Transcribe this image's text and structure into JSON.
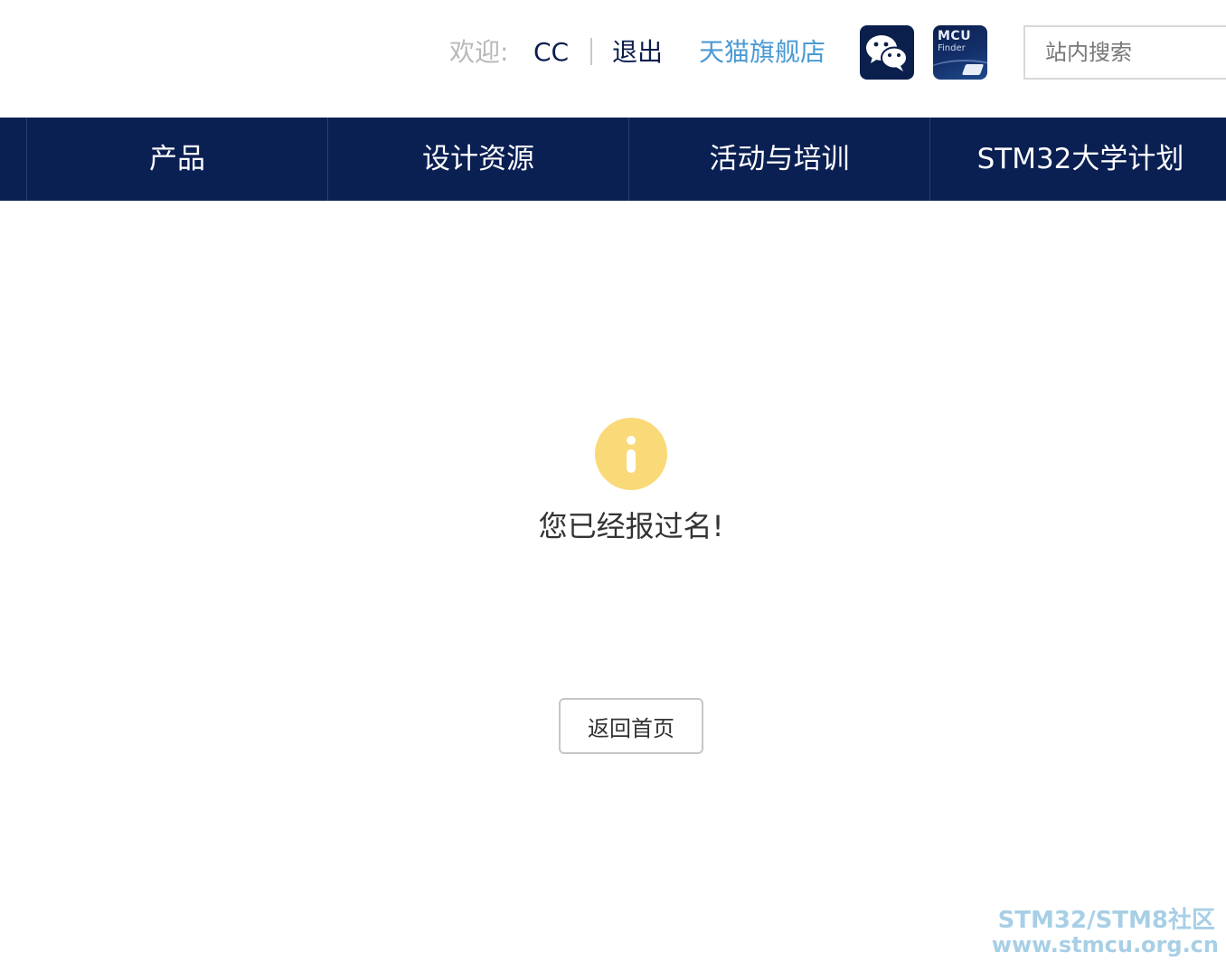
{
  "header": {
    "welcome_label": "欢迎:",
    "username": "CC",
    "logout_label": "退出",
    "tmall_store_label": "天猫旗舰店",
    "wechat_icon": "wechat-icon",
    "mcu_finder": {
      "line1": "MCU",
      "line2": "Finder"
    },
    "search": {
      "placeholder": "站内搜索"
    }
  },
  "nav": {
    "items": [
      {
        "label": "产品"
      },
      {
        "label": "设计资源"
      },
      {
        "label": "活动与培训"
      },
      {
        "label": "STM32大学计划"
      }
    ]
  },
  "main": {
    "status_icon": "info-icon",
    "message": "您已经报过名!",
    "home_button_label": "返回首页"
  },
  "watermark": {
    "line1": "STM32/STM8社区",
    "line2": "www.stmcu.org.cn"
  },
  "colors": {
    "nav_background": "#0a1f52",
    "info_icon": "#fad978",
    "link_blue": "#4a9ad4"
  }
}
